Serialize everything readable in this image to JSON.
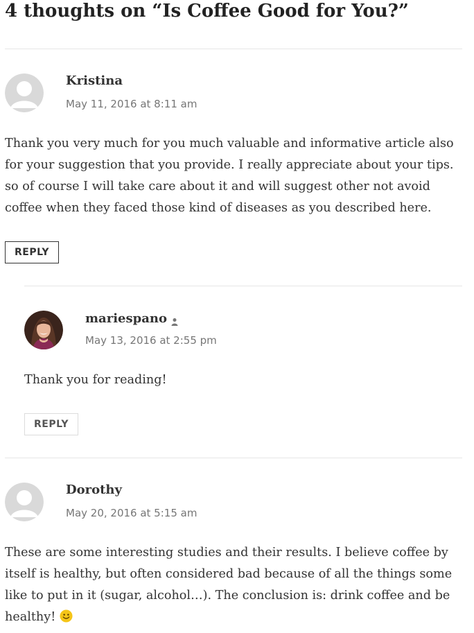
{
  "comments_section": {
    "title": "4 thoughts on “Is Coffee Good for You?”"
  },
  "comments": [
    {
      "author": "Kristina",
      "date": "May 11, 2016 at 8:11 am",
      "text": "Thank you very much for you much valuable and informative article also for your suggestion that you provide. I really appreciate about your tips. so of course I will take care about it and will suggest other not avoid coffee when they faced those kind of diseases as you described here.",
      "reply_label": "REPLY",
      "avatar_icon": "default-avatar-icon"
    },
    {
      "author": "mariespano",
      "is_post_author": true,
      "author_badge_icon": "post-author-icon",
      "date": "May 13, 2016 at 2:55 pm",
      "text": "Thank you for reading!",
      "reply_label": "REPLY",
      "avatar_icon": "user-photo-avatar"
    },
    {
      "author": "Dorothy",
      "date": "May 20, 2016 at 5:15 am",
      "text": "These are some interesting studies and their results. I believe coffee by itself is healthy, but often considered bad because of all the things some like to put in it (sugar, alcohol…). The conclusion is: drink coffee and be healthy! ",
      "trailing_icon": "smiley-emoji-icon",
      "avatar_icon": "default-avatar-icon"
    }
  ],
  "colors": {
    "text": "#333333",
    "meta": "#767676",
    "divider": "#e6e6e6",
    "avatar_bg": "#d9d9d9",
    "avatar_fg": "#ffffff",
    "smiley": "#f5c518"
  }
}
